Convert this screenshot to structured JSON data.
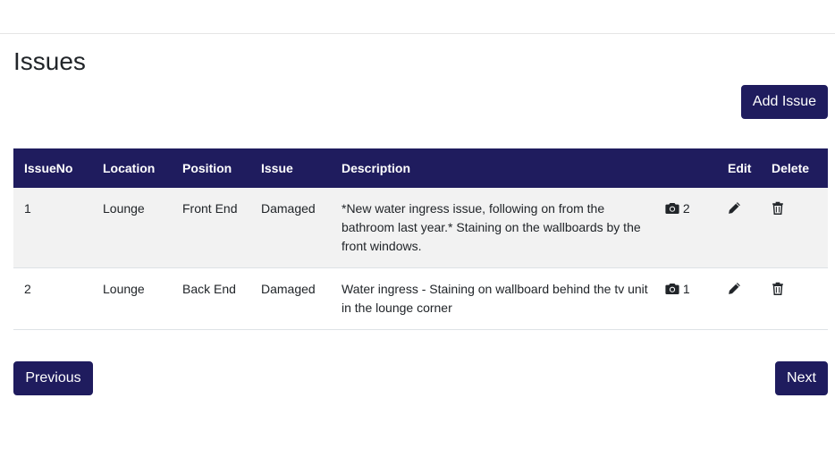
{
  "page": {
    "title": "Issues",
    "add_button": "Add Issue",
    "prev_button": "Previous",
    "next_button": "Next"
  },
  "table": {
    "headers": {
      "issue_no": "IssueNo",
      "location": "Location",
      "position": "Position",
      "issue": "Issue",
      "description": "Description",
      "photos": "",
      "edit": "Edit",
      "delete": "Delete"
    },
    "rows": [
      {
        "issue_no": "1",
        "location": "Lounge",
        "position": "Front End",
        "issue": "Damaged",
        "description": "*New water ingress issue, following on from the bathroom last year.* Staining on the wallboards by the front windows.",
        "photo_count": "2"
      },
      {
        "issue_no": "2",
        "location": "Lounge",
        "position": "Back End",
        "issue": "Damaged",
        "description": "Water ingress - Staining on wallboard behind the tv unit in the lounge corner",
        "photo_count": "1"
      }
    ]
  },
  "icons": {
    "photo": "camera-icon",
    "edit": "pencil-icon",
    "delete": "trash-icon"
  },
  "colors": {
    "primary": "#1f1c5e",
    "row_stripe": "#f2f2f2"
  }
}
